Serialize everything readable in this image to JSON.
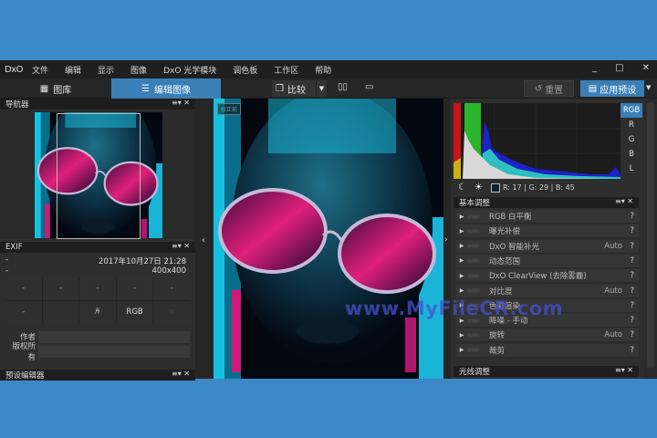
{
  "menubar": {
    "logo": "DxO",
    "items": [
      "文件",
      "编辑",
      "显示",
      "图像",
      "DxO 光学模块",
      "调色板",
      "工作区",
      "帮助"
    ],
    "window_controls": [
      "_",
      "□",
      "✕"
    ]
  },
  "toolbar": {
    "library_tab": "图库",
    "edit_tab": "编辑图像",
    "compare": "比较",
    "reset": "重置",
    "apply_preset": "应用预设"
  },
  "navigator": {
    "title": "导航器"
  },
  "exif": {
    "title": "EXIF",
    "rows": [
      {
        "left": "-",
        "right": "2017年10月27日 21:28"
      },
      {
        "left": "-",
        "right": "400x400"
      }
    ],
    "grid": [
      "-",
      "-",
      "-",
      "-",
      "-",
      "-",
      "",
      "flash-off-icon",
      "RGB",
      "location-icon"
    ],
    "author_label": "作者",
    "author_value": "",
    "copyright_label": "版权所有",
    "copyright_value": ""
  },
  "preset_editor": {
    "title": "预设编辑器"
  },
  "viewer": {
    "tag": "校正前"
  },
  "histogram": {
    "channels": [
      "RGB",
      "R",
      "G",
      "B",
      "L"
    ],
    "active_channel": "RGB",
    "readout": "R: 17 | G: 29 | B: 45"
  },
  "basic_adjust": {
    "title": "基本调整",
    "items": [
      {
        "label": "RGB 白平衡",
        "auto": "",
        "help": "?"
      },
      {
        "label": "曝光补偿",
        "auto": "",
        "help": "?"
      },
      {
        "label": "DxO 智能补光",
        "auto": "Auto",
        "help": "?"
      },
      {
        "label": "动态范围",
        "auto": "",
        "help": "?"
      },
      {
        "label": "DxO ClearView (去除雾霾)",
        "auto": "",
        "help": "?"
      },
      {
        "label": "对比度",
        "auto": "Auto",
        "help": "?"
      },
      {
        "label": "色彩渲染",
        "auto": "",
        "help": "?"
      },
      {
        "label": "降噪 - 手动",
        "auto": "",
        "help": "?"
      },
      {
        "label": "旋转",
        "auto": "Auto",
        "help": "?"
      },
      {
        "label": "裁剪",
        "auto": "",
        "help": "?"
      }
    ]
  },
  "light_adjust": {
    "title": "光线调整"
  },
  "panel_controls": "≡▾ ✕",
  "watermark": "www.MyFileCR.com",
  "colors": {
    "accent": "#3a7fb6",
    "background": "#3c88c6",
    "panel": "#2e2e2e"
  }
}
